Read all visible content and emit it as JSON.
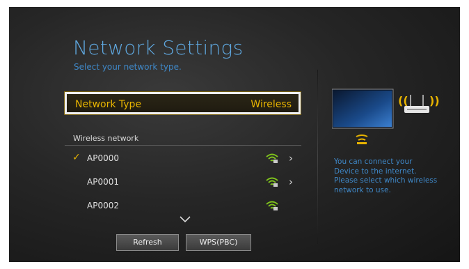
{
  "header": {
    "title": "Network Settings",
    "subtitle": "Select your network type."
  },
  "network_type": {
    "label": "Network Type",
    "value": "Wireless"
  },
  "wireless_section": {
    "label": "Wireless network",
    "networks": [
      {
        "name": "AP0000",
        "selected": true,
        "has_arrow": true,
        "icon": "wifi-signal-icon"
      },
      {
        "name": "AP0001",
        "selected": false,
        "has_arrow": true,
        "icon": "wifi-signal-icon"
      },
      {
        "name": "AP0002",
        "selected": false,
        "has_arrow": false,
        "icon": "wifi-signal-icon"
      }
    ],
    "check_glyph": "✓",
    "arrow_glyph": "›"
  },
  "buttons": {
    "refresh": "Refresh",
    "wps": "WPS(PBC)"
  },
  "info": {
    "text": "You can connect your Device to the internet. Please select which wireless network to use."
  },
  "colors": {
    "accent_yellow": "#e8b400",
    "accent_blue": "#3f88c8",
    "wifi_green": "#7ec21c"
  }
}
